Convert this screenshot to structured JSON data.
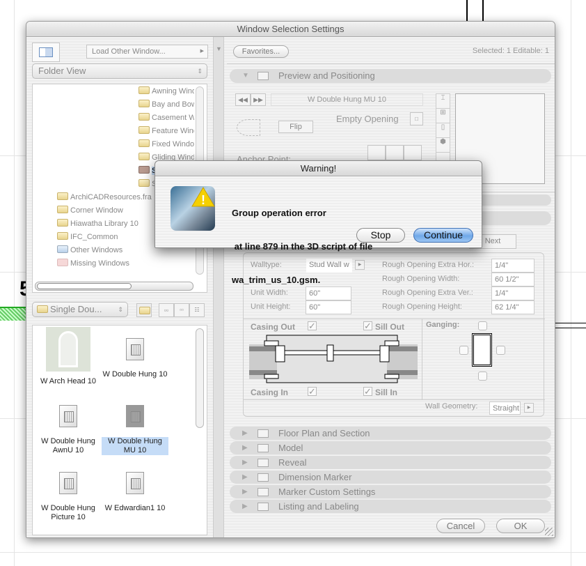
{
  "background": {
    "glyph": "5"
  },
  "dialog": {
    "title": "Window Selection Settings",
    "left": {
      "load_other": "Load Other Window...",
      "view_select": "Folder View",
      "tree": [
        {
          "label": "Awning Windows",
          "type": "folder"
        },
        {
          "label": "Bay and Bow",
          "type": "folder"
        },
        {
          "label": "Casement W",
          "type": "folder"
        },
        {
          "label": "Feature Wind",
          "type": "folder"
        },
        {
          "label": "Fixed Windo",
          "type": "folder"
        },
        {
          "label": "Gliding Wind",
          "type": "folder"
        },
        {
          "label": "S",
          "type": "folder",
          "selected": true
        },
        {
          "label": "S",
          "type": "folder"
        },
        {
          "label": "ArchiCADResources.fra",
          "type": "folder"
        },
        {
          "label": "Corner Window",
          "type": "folder"
        },
        {
          "label": "Hiawatha Library 10",
          "type": "folder",
          "expandable": true
        },
        {
          "label": "IFC_Common",
          "type": "folder"
        },
        {
          "label": "Other Windows",
          "type": "special"
        },
        {
          "label": "Missing Windows",
          "type": "missing"
        }
      ],
      "folder_select": "Single Dou...",
      "library_items": [
        {
          "label": "W Arch Head 10",
          "thumb": "arch-window"
        },
        {
          "label": "W Double Hung 10",
          "thumb": "document"
        },
        {
          "label": "W Double Hung AwnU 10",
          "thumb": "document"
        },
        {
          "label": "W Double Hung MU 10",
          "thumb": "document",
          "selected": true
        },
        {
          "label": "W Double Hung Picture 10",
          "thumb": "document"
        },
        {
          "label": "W Edwardian1 10",
          "thumb": "document"
        }
      ]
    },
    "right": {
      "favorites": "Favorites...",
      "selected_info": "Selected: 1 Editable: 1",
      "preview_panel": {
        "title": "Preview and Positioning",
        "object_name": "W Double Hung MU 10",
        "empty_opening": "Empty Opening",
        "flip": "Flip",
        "anchor_point": "Anchor Point:"
      },
      "next": "Next",
      "params": {
        "walltype_label": "Walltype:",
        "walltype_value": "Stud Wall w",
        "unit_width_label": "Unit Width:",
        "unit_width": "60\"",
        "unit_height_label": "Unit Height:",
        "unit_height": "60\"",
        "ro_extra_hor_label": "Rough Opening Extra Hor.:",
        "ro_extra_hor": "1/4\"",
        "ro_width_label": "Rough Opening Width:",
        "ro_width": "60 1/2\"",
        "ro_extra_ver_label": "Rough Opening Extra Ver.:",
        "ro_extra_ver": "1/4\"",
        "ro_height_label": "Rough Opening Height:",
        "ro_height": "62 1/4\"",
        "casing_out": "Casing Out",
        "sill_out": "Sill Out",
        "casing_in": "Casing In",
        "sill_in": "Sill In",
        "ganging": "Ganging:",
        "wall_geometry_label": "Wall Geometry:",
        "wall_geometry": "Straight"
      },
      "panels": [
        "Floor Plan and Section",
        "Model",
        "Reveal",
        "Dimension Marker",
        "Marker Custom Settings",
        "Listing and Labeling"
      ],
      "cancel": "Cancel",
      "ok": "OK"
    }
  },
  "warning": {
    "title": "Warning!",
    "line1": "Group operation error",
    "line2": " at line 879 in the 3D script of file",
    "line3": "wa_trim_us_10.gsm.",
    "stop": "Stop",
    "continue": "Continue"
  },
  "colors": {
    "accent": "#6fa8e8",
    "selection": "#c5dcf7"
  }
}
